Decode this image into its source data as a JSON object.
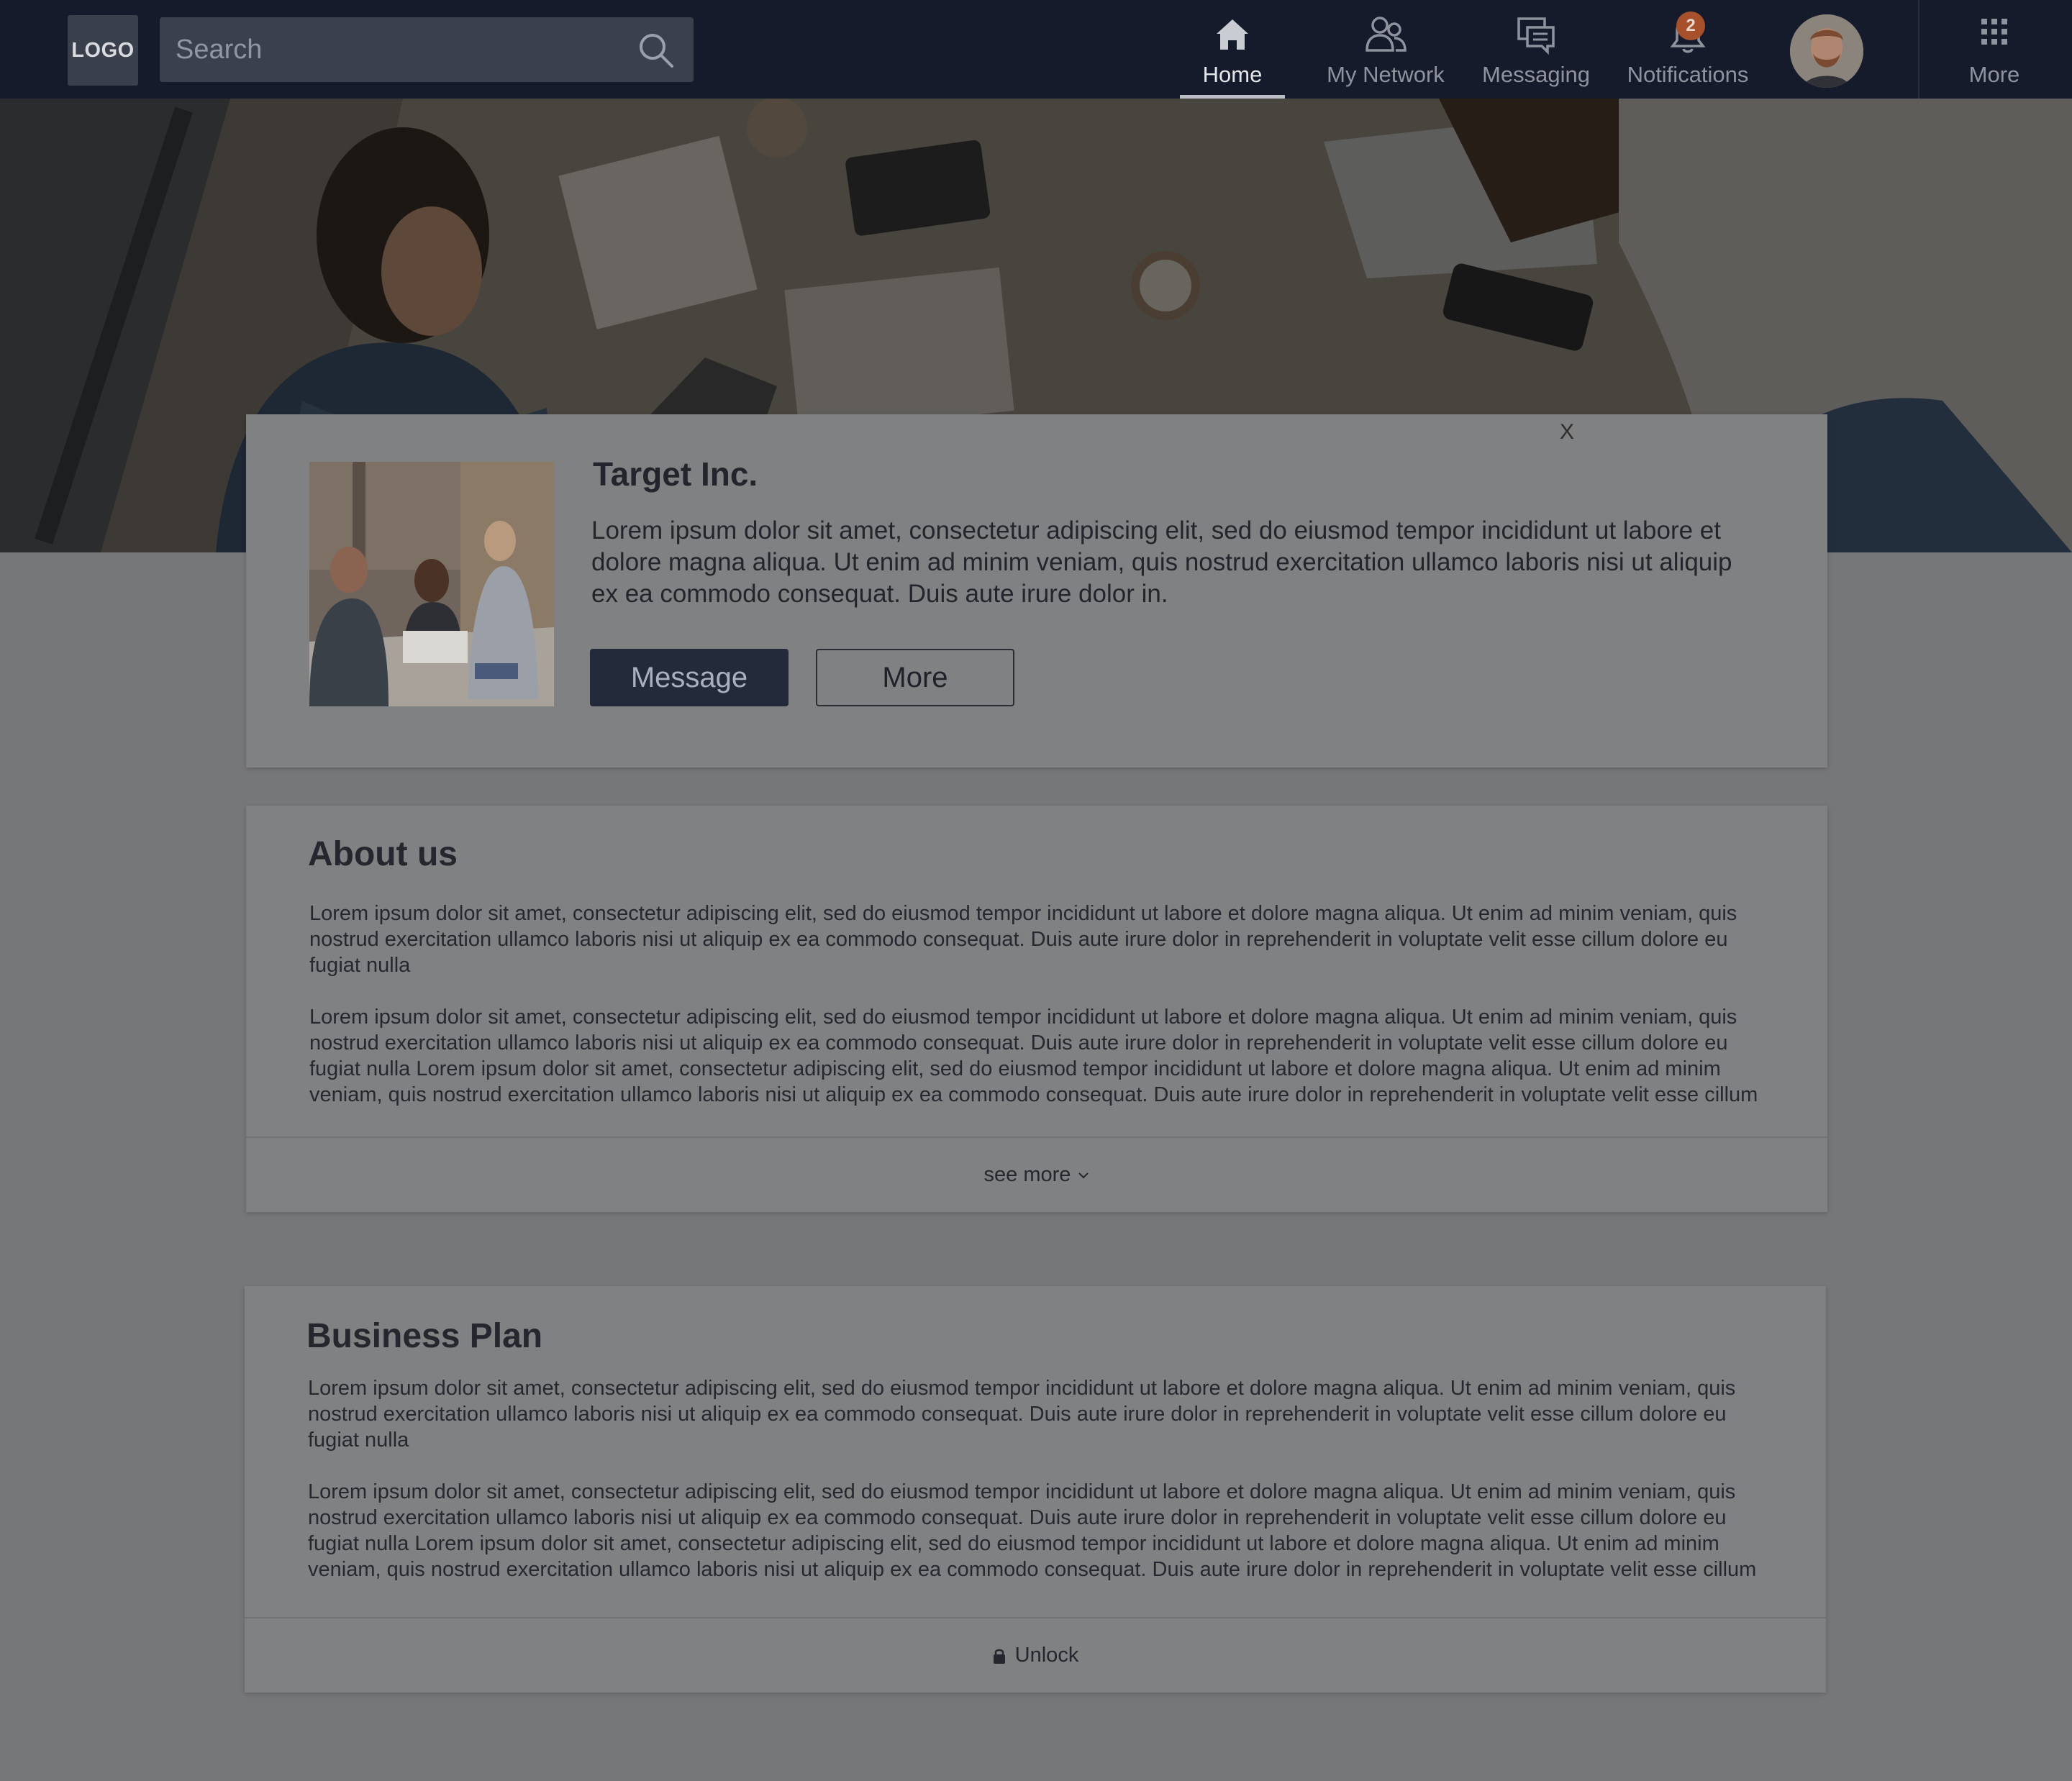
{
  "nav": {
    "logo_text": "LOGO",
    "search_placeholder": "Search",
    "items": [
      {
        "label": "Home",
        "icon": "home-icon",
        "active": true
      },
      {
        "label": "My Network",
        "icon": "network-icon",
        "active": false
      },
      {
        "label": "Messaging",
        "icon": "messaging-icon",
        "active": false
      },
      {
        "label": "Notifications",
        "icon": "bell-icon",
        "active": false,
        "badge": "2"
      }
    ],
    "more_label": "More"
  },
  "hero": {
    "close_label": "X"
  },
  "company": {
    "name": "Target Inc.",
    "description": "Lorem ipsum dolor sit amet, consectetur adipiscing elit, sed do eiusmod tempor incididunt ut labore et dolore magna aliqua. Ut enim ad minim veniam, quis nostrud exercitation ullamco laboris nisi ut aliquip ex ea commodo consequat. Duis aute irure dolor in.",
    "message_button": "Message",
    "more_button": "More"
  },
  "about": {
    "title": "About us",
    "paragraphs": [
      "Lorem ipsum dolor sit amet, consectetur adipiscing elit, sed do eiusmod tempor incididunt ut labore et dolore magna aliqua. Ut enim ad minim veniam, quis nostrud exercitation ullamco laboris nisi ut aliquip ex ea commodo consequat. Duis aute irure dolor in reprehenderit in voluptate velit esse cillum dolore eu fugiat nulla",
      "Lorem ipsum dolor sit amet, consectetur adipiscing elit, sed do eiusmod tempor incididunt ut labore et dolore magna aliqua. Ut enim ad minim veniam, quis nostrud exercitation ullamco laboris nisi ut aliquip ex ea commodo consequat. Duis aute irure dolor in reprehenderit in voluptate velit esse cillum dolore eu fugiat nulla Lorem ipsum dolor sit amet, consectetur adipiscing elit, sed do eiusmod tempor incididunt ut labore et dolore magna aliqua. Ut enim ad minim veniam, quis nostrud exercitation ullamco laboris nisi ut aliquip ex ea commodo consequat. Duis aute irure dolor in reprehenderit in voluptate velit esse cillum"
    ],
    "footer_label": "see more"
  },
  "plan": {
    "title": "Business Plan",
    "paragraphs": [
      "Lorem ipsum dolor sit amet, consectetur adipiscing elit, sed do eiusmod tempor incididunt ut labore et dolore magna aliqua. Ut enim ad minim veniam, quis nostrud exercitation ullamco laboris nisi ut aliquip ex ea commodo consequat. Duis aute irure dolor in reprehenderit in voluptate velit esse cillum dolore eu fugiat nulla",
      "Lorem ipsum dolor sit amet, consectetur adipiscing elit, sed do eiusmod tempor incididunt ut labore et dolore magna aliqua. Ut enim ad minim veniam, quis nostrud exercitation ullamco laboris nisi ut aliquip ex ea commodo consequat. Duis aute irure dolor in reprehenderit in voluptate velit esse cillum dolore eu fugiat nulla Lorem ipsum dolor sit amet, consectetur adipiscing elit, sed do eiusmod tempor incididunt ut labore et dolore magna aliqua. Ut enim ad minim veniam, quis nostrud exercitation ullamco laboris nisi ut aliquip ex ea commodo consequat. Duis aute irure dolor in reprehenderit in voluptate velit esse cillum"
    ],
    "footer_label": "Unlock",
    "footer_icon": "lock-icon"
  },
  "colors": {
    "nav_bg": "#151b2b",
    "page_overlay_bg": "#767779",
    "card_bg": "#808183",
    "message_button_bg": "#232a39",
    "badge_bg": "#a6512c"
  }
}
